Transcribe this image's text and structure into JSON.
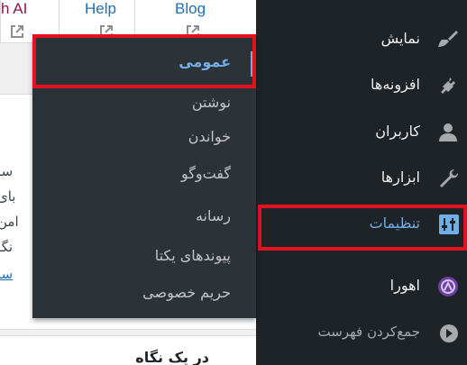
{
  "top_links": {
    "ai_label": "h AI",
    "help_label": "Help",
    "blog_label": "Blog"
  },
  "background_text": {
    "line1": "سا",
    "line2": "بای",
    "line3": "امن",
    "line4": "نگا",
    "line5_link": "سا",
    "widget_title": "در یک نگاه"
  },
  "sidebar": {
    "items": [
      {
        "label": "نمایش",
        "icon": "appearance-brush-icon"
      },
      {
        "label": "افزونه‌ها",
        "icon": "plugins-plug-icon"
      },
      {
        "label": "کاربران",
        "icon": "users-person-icon"
      },
      {
        "label": "ابزارها",
        "icon": "tools-wrench-icon"
      },
      {
        "label": "تنظیمات",
        "icon": "settings-sliders-icon",
        "active": true
      },
      {
        "label": "اهورا",
        "icon": "ahura-logo-icon"
      },
      {
        "label": "جمع‌کردن فهرست",
        "icon": "collapse-menu-icon"
      }
    ]
  },
  "settings_submenu": {
    "items": [
      {
        "label": "عمومی",
        "current": true
      },
      {
        "label": "نوشتن"
      },
      {
        "label": "خواندن"
      },
      {
        "label": "گفت‌وگو"
      },
      {
        "label": "رسانه"
      },
      {
        "label": "پیوندهای یکتا"
      },
      {
        "label": "حریم خصوصی"
      }
    ]
  },
  "colors": {
    "sidebar_bg": "#1d2327",
    "submenu_bg": "#2c3338",
    "accent": "#72aee6",
    "highlight": "#e4121f",
    "link": "#2271b1"
  }
}
